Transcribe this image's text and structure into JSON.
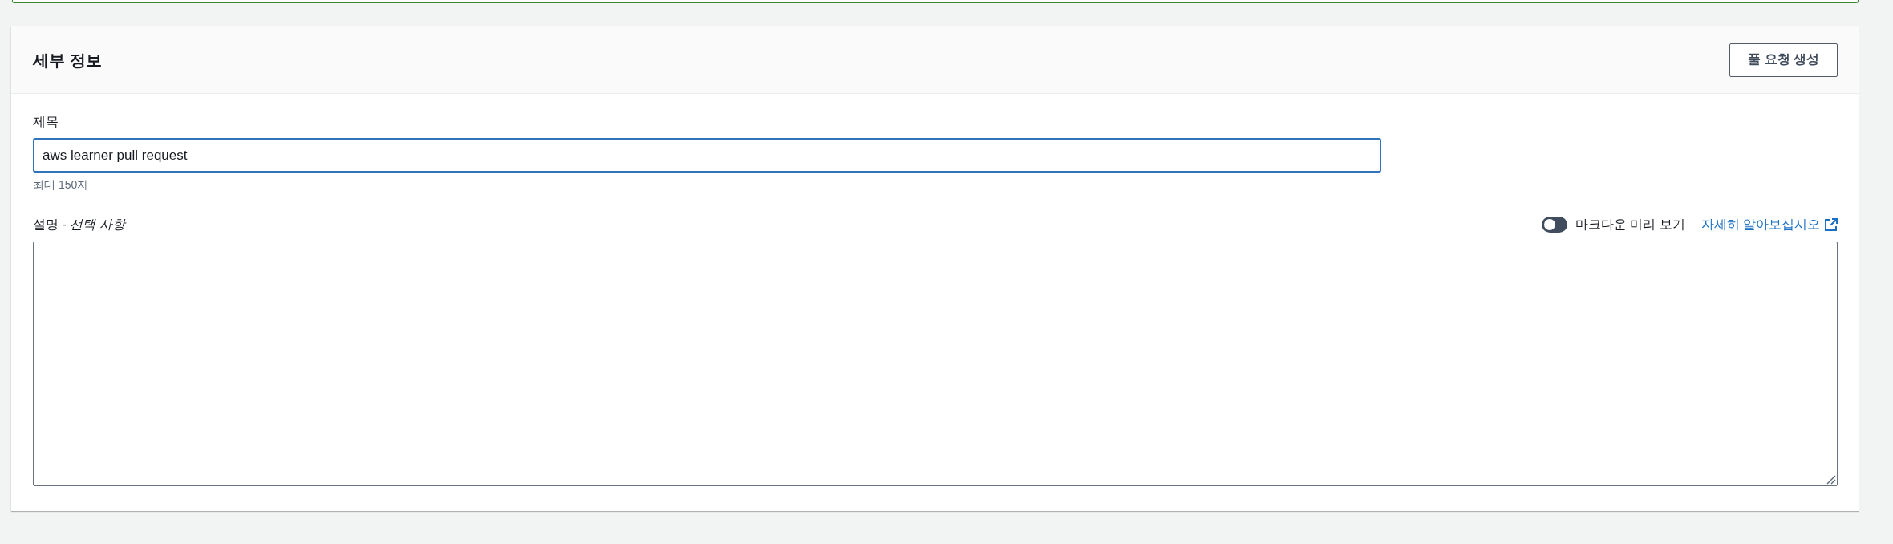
{
  "details_panel": {
    "title": "세부 정보",
    "action_button": "풀 요청 생성",
    "title_field": {
      "label": "제목",
      "value": "aws learner pull request",
      "focused": true,
      "hint": "최대 150자"
    },
    "description_field": {
      "label": "설명 - *선택 사항*",
      "markdown_preview_toggle": {
        "label": "마크다운 미리 보기",
        "on": false
      },
      "learn_more_link": "자세히 알아보십시오"
    }
  }
}
